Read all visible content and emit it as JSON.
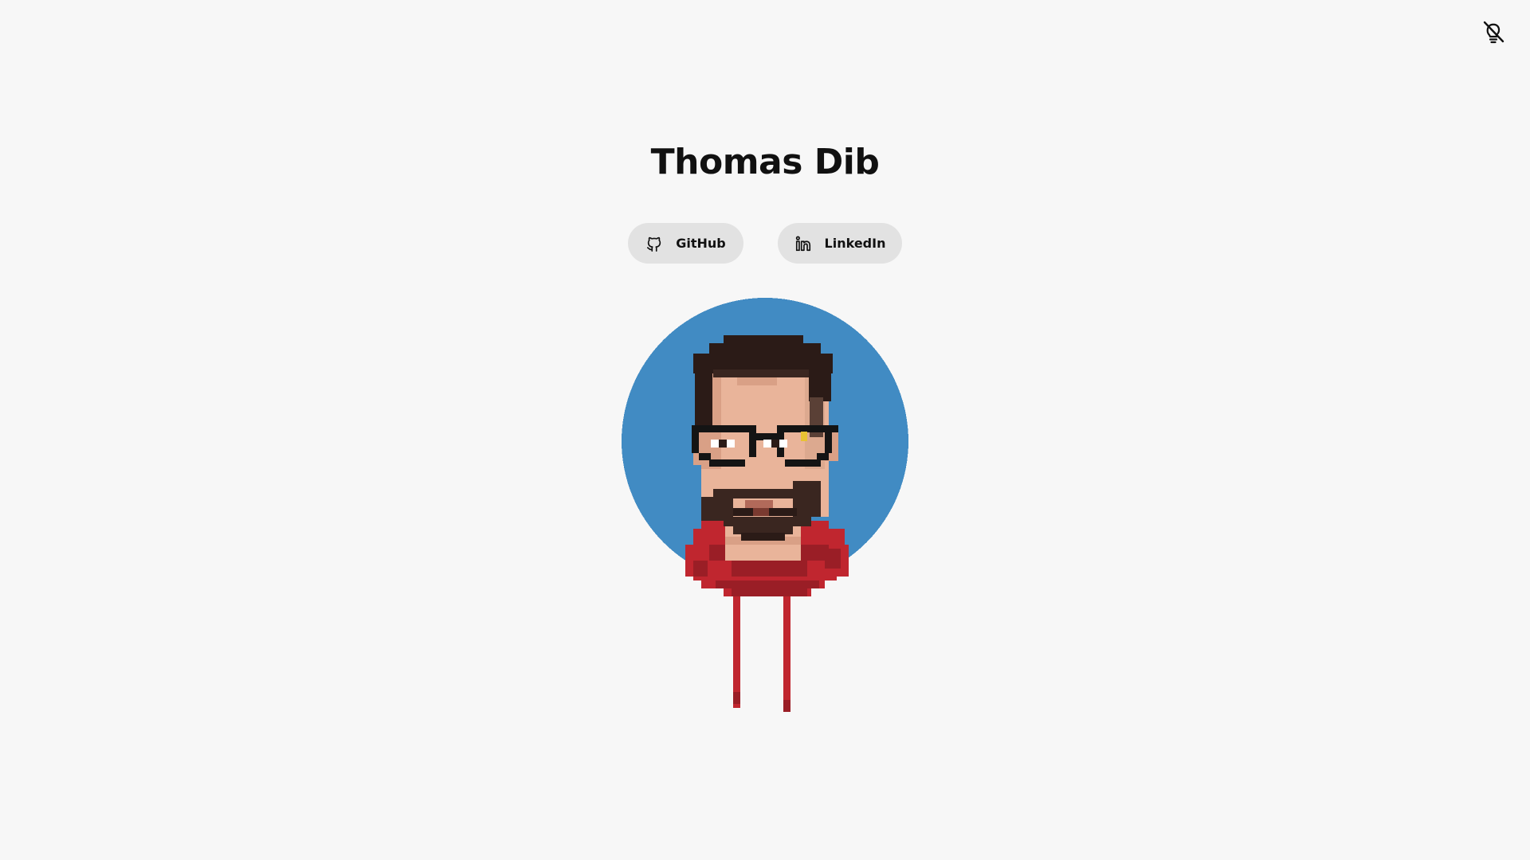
{
  "header": {
    "theme_toggle_icon": "lightbulb-off-icon"
  },
  "profile": {
    "name": "Thomas Dib"
  },
  "links": [
    {
      "label": "GitHub",
      "icon": "github-icon"
    },
    {
      "label": "LinkedIn",
      "icon": "linkedin-icon"
    }
  ],
  "avatar": {
    "description_icon": "pixel-avatar",
    "colors": {
      "background_circle": "#418bc3",
      "hair": "#2b1b17",
      "skin": "#e9b49a",
      "glasses": "#141414",
      "beard": "#3a2620",
      "hoodie": "#c0262f",
      "hoodie_shadow": "#9a1e26"
    }
  }
}
